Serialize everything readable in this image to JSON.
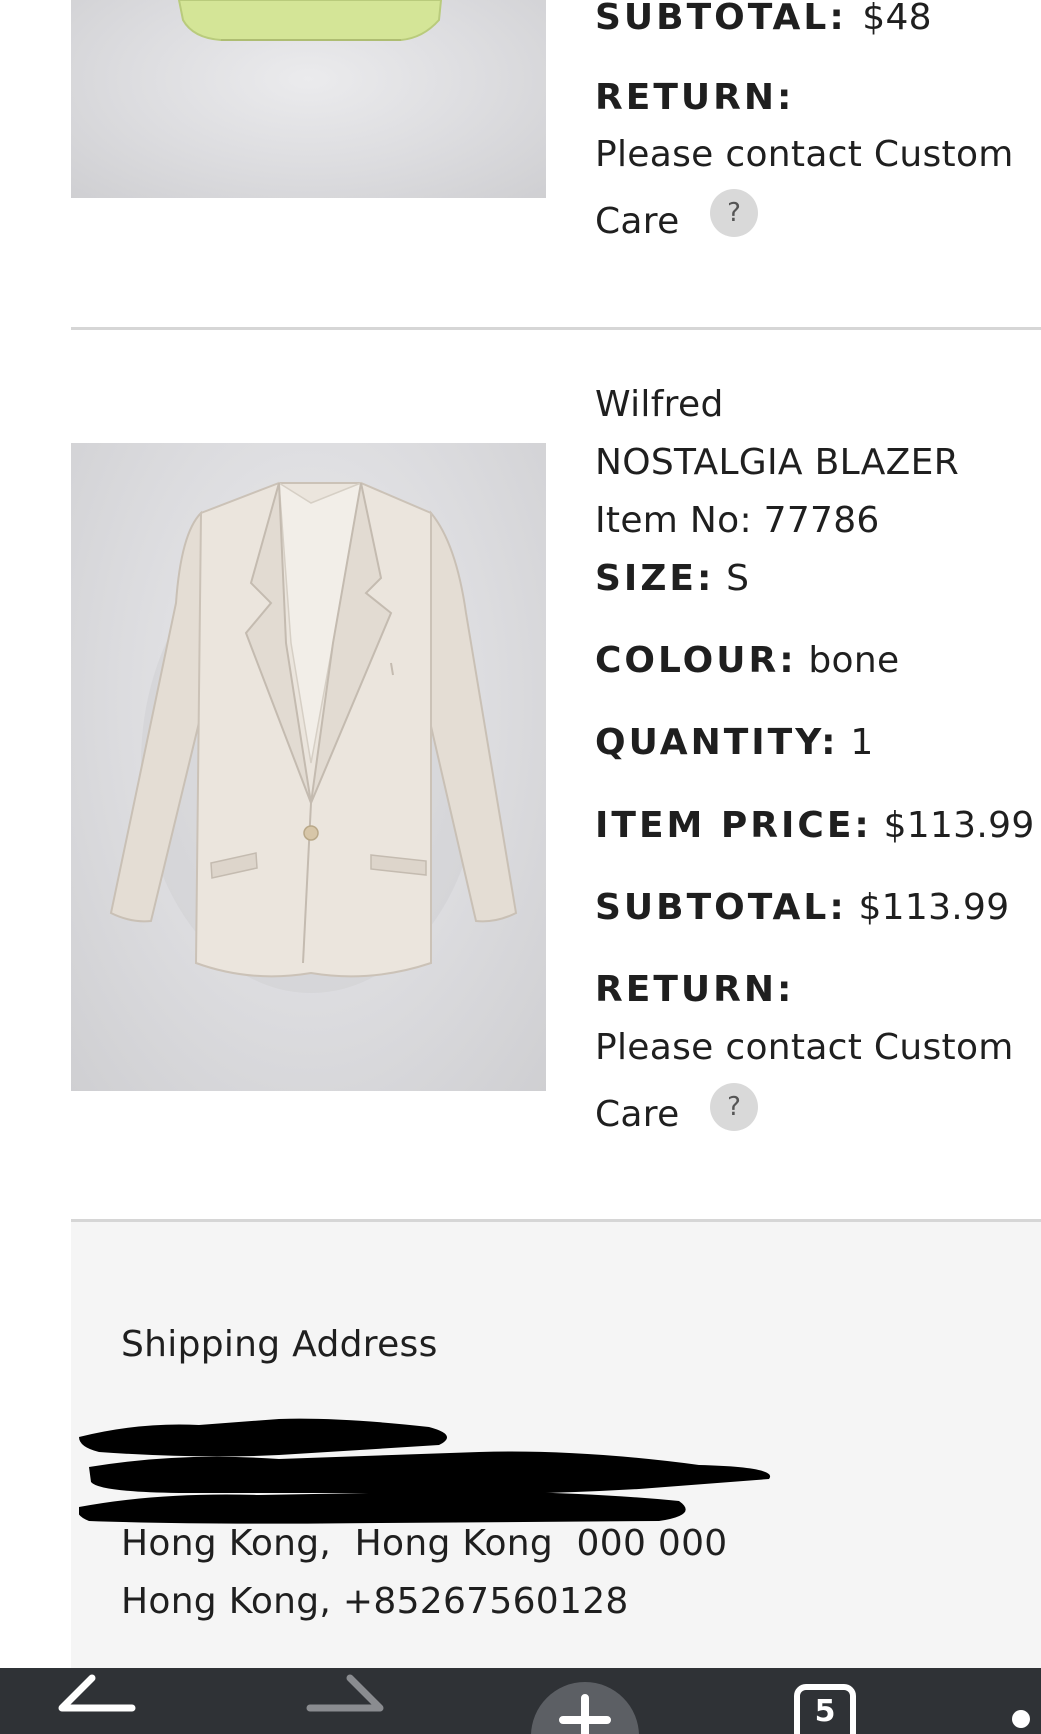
{
  "item1": {
    "subtotal_label": "SUBTOTAL:",
    "subtotal_value": "$48",
    "return_label": "RETURN:",
    "return_text_1": "Please contact Custom",
    "return_text_2": "Care",
    "help_symbol": "?",
    "image_icon": "lime-top-photo"
  },
  "item2": {
    "brand": "Wilfred",
    "name": "NOSTALGIA BLAZER",
    "item_no": "Item No: 77786",
    "size_label": "SIZE:",
    "size_value": "S",
    "colour_label": "COLOUR:",
    "colour_value": "bone",
    "quantity_label": "QUANTITY:",
    "quantity_value": "1",
    "item_price_label": "ITEM PRICE:",
    "item_price_value": "$113.99",
    "subtotal_label": "SUBTOTAL:",
    "subtotal_value": "$113.99",
    "return_label": "RETURN:",
    "return_text_1": "Please contact Custom",
    "return_text_2": "Care",
    "help_symbol": "?",
    "image_icon": "bone-blazer-photo"
  },
  "shipping": {
    "title": "Shipping Address",
    "city_line": "Hong Kong,  Hong Kong  000 000",
    "phone_line": "Hong Kong, +85267560128"
  },
  "nav": {
    "back_icon": "back-arrow-icon",
    "forward_icon": "forward-arrow-icon",
    "new_tab_icon": "plus-icon",
    "tabs_count": "5",
    "menu_icon": "more-icon"
  },
  "colors": {
    "page_bg": "#ffffff",
    "shipping_bg": "#f5f5f5",
    "divider": "#d6d6d6",
    "nav_bar": "#2f3236",
    "lime": "#d4e597",
    "bone": "#e8e2da"
  }
}
